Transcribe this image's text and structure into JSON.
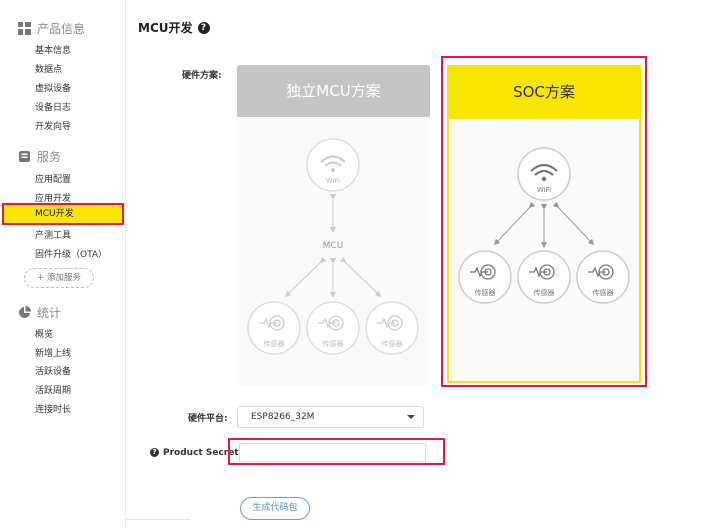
{
  "sidebar": {
    "sections": [
      {
        "title": "产品信息",
        "icon": "grid-icon",
        "items": [
          "基本信息",
          "数据点",
          "虚拟设备",
          "设备日志",
          "开发向导"
        ]
      },
      {
        "title": "服务",
        "icon": "service-icon",
        "items": [
          "应用配置",
          "应用开发",
          "MCU开发",
          "产测工具",
          "固件升级（OTA）"
        ]
      },
      {
        "title": "统计",
        "icon": "pie-icon",
        "items": [
          "概览",
          "新增上线",
          "活跃设备",
          "活跃周期",
          "连接时长"
        ]
      }
    ],
    "add_service": "+ 添加服务"
  },
  "main": {
    "title": "MCU开发",
    "hardware_scheme_label": "硬件方案:",
    "mcu_card": {
      "title": "独立MCU方案",
      "wifi": "WiFi",
      "mcu": "MCU",
      "sensors": [
        "传感器",
        "传感器",
        "传感器"
      ]
    },
    "soc_card": {
      "title": "SOC方案",
      "wifi": "WiFi",
      "sensors": [
        "传感器",
        "传感器",
        "传感器"
      ]
    },
    "platform_label": "硬件平台:",
    "platform_value": "ESP8266_32M",
    "secret_label": "Product Secret:",
    "secret_value": "",
    "generate_button": "生成代码包"
  },
  "colors": {
    "accent_yellow": "#f7e600",
    "highlight_red": "#e8154b",
    "button_blue": "#5fa3d6"
  }
}
